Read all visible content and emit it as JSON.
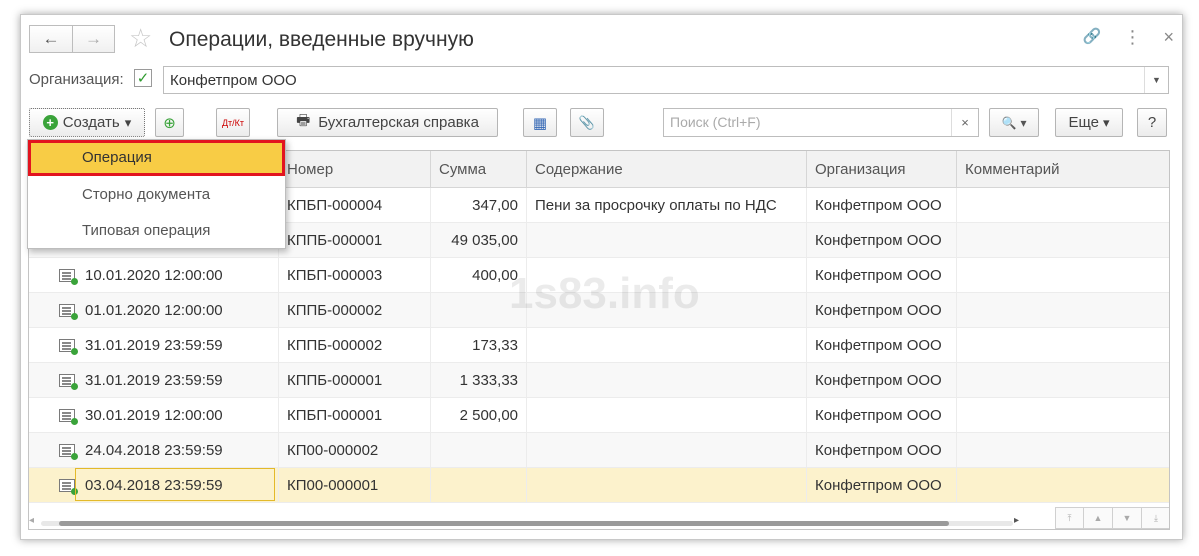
{
  "window": {
    "title": "Операции, введенные вручную",
    "back_icon": "←",
    "forward_icon": "→",
    "star_icon": "☆",
    "link_icon": "🔗",
    "more_icon": "⋮",
    "close_icon": "×"
  },
  "org": {
    "label": "Организация:",
    "checked": "✓",
    "value": "Конфетпром ООО",
    "dropdown_icon": "▼"
  },
  "toolbar": {
    "create_label": "Создать",
    "create_icon": "+",
    "caret": "▾",
    "copy_icon": "⊕",
    "dt_kt_icon": "Дт/Кт",
    "report_icon": "🖶",
    "report_label": "Бухгалтерская справка",
    "structure_icon": "▦",
    "attach_icon": "📎",
    "search_placeholder": "Поиск (Ctrl+F)",
    "search_clear": "×",
    "search_icon": "🔍",
    "more_label": "Еще",
    "help_label": "?"
  },
  "dropdown": {
    "items": [
      "Операция",
      "Сторно документа",
      "Типовая операция"
    ]
  },
  "table": {
    "columns": [
      "Номер",
      "Сумма",
      "Содержание",
      "Организация",
      "Комментарий"
    ],
    "rows": [
      {
        "date": "",
        "number": "КПБП-000004",
        "amount": "347,00",
        "content": "Пени за просрочку оплаты по НДС",
        "org": "Конфетпром ООО",
        "comment": ""
      },
      {
        "date": "",
        "number": "КППБ-000001",
        "amount": "49 035,00",
        "content": "",
        "org": "Конфетпром ООО",
        "comment": ""
      },
      {
        "date": "10.01.2020 12:00:00",
        "number": "КПБП-000003",
        "amount": "400,00",
        "content": "",
        "org": "Конфетпром ООО",
        "comment": ""
      },
      {
        "date": "01.01.2020 12:00:00",
        "number": "КППБ-000002",
        "amount": "",
        "content": "",
        "org": "Конфетпром ООО",
        "comment": ""
      },
      {
        "date": "31.01.2019 23:59:59",
        "number": "КППБ-000002",
        "amount": "173,33",
        "content": "",
        "org": "Конфетпром ООО",
        "comment": ""
      },
      {
        "date": "31.01.2019 23:59:59",
        "number": "КППБ-000001",
        "amount": "1 333,33",
        "content": "",
        "org": "Конфетпром ООО",
        "comment": ""
      },
      {
        "date": "30.01.2019 12:00:00",
        "number": "КПБП-000001",
        "amount": "2 500,00",
        "content": "",
        "org": "Конфетпром ООО",
        "comment": ""
      },
      {
        "date": "24.04.2018 23:59:59",
        "number": "КП00-000002",
        "amount": "",
        "content": "",
        "org": "Конфетпром ООО",
        "comment": ""
      },
      {
        "date": "03.04.2018 23:59:59",
        "number": "КП00-000001",
        "amount": "",
        "content": "",
        "org": "Конфетпром ООО",
        "comment": ""
      }
    ]
  },
  "watermark": "1s83.info",
  "scroll": {
    "right_arrow": "▸",
    "first": "⤒",
    "up": "▲",
    "down": "▼",
    "last": "⤓"
  },
  "colors": {
    "accent_yellow": "#f8cc45",
    "highlight_red": "#e2141f",
    "selected_row": "#fcf2cc",
    "green": "#3aa33a"
  }
}
